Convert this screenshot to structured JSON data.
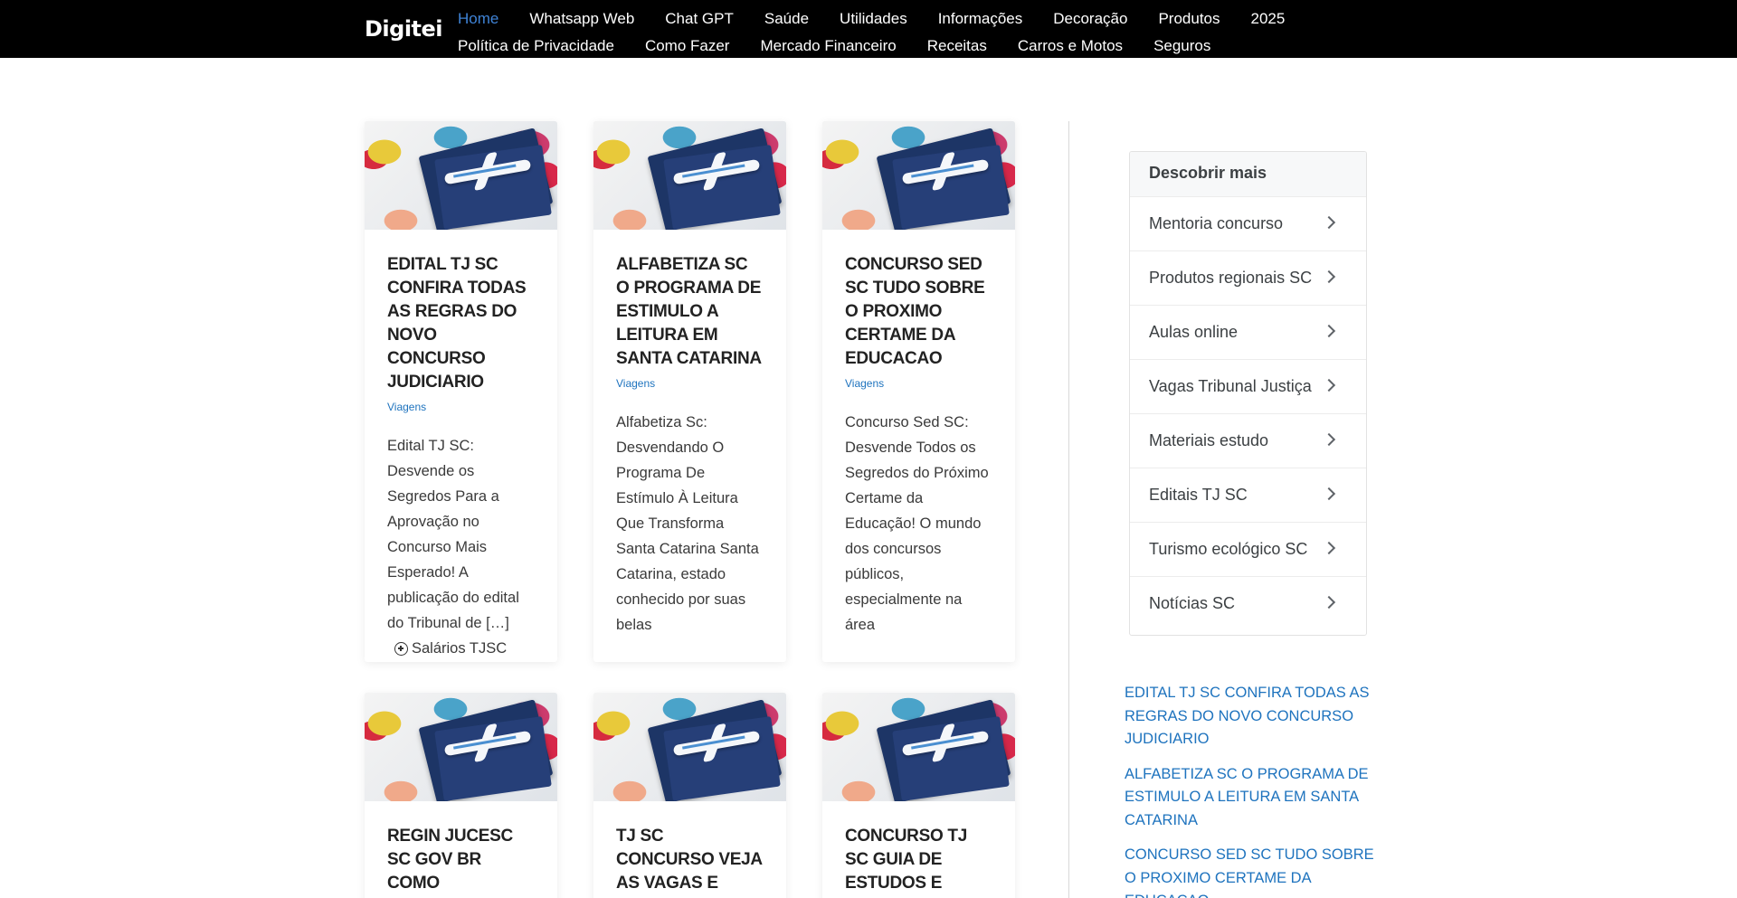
{
  "site": {
    "logo": "Digitei"
  },
  "nav": {
    "row1": [
      "Home",
      "Whatsapp Web",
      "Chat GPT",
      "Saúde",
      "Utilidades",
      "Informações",
      "Decoração",
      "Produtos",
      "2025"
    ],
    "row2": [
      "Política de Privacidade",
      "Como Fazer",
      "Mercado Financeiro",
      "Receitas",
      "Carros e Motos",
      "Seguros"
    ],
    "active": "Home"
  },
  "posts": [
    {
      "title": "EDITAL TJ SC CONFIRA TODAS AS REGRAS DO NOVO CONCURSO JUDICIARIO",
      "category": "Viagens",
      "excerpt": "Edital TJ SC: Desvende os Segredos Para a Aprovação no Concurso Mais Esperado! A publicação do edital do Tribunal de […]",
      "extra": "Salários TJSC"
    },
    {
      "title": "ALFABETIZA SC O PROGRAMA DE ESTIMULO A LEITURA EM SANTA CATARINA",
      "category": "Viagens",
      "excerpt": "Alfabetiza Sc: Desvendando O Programa De Estímulo À Leitura Que Transforma Santa Catarina Santa Catarina, estado conhecido por suas belas"
    },
    {
      "title": "CONCURSO SED SC TUDO SOBRE O PROXIMO CERTAME DA EDUCACAO",
      "category": "Viagens",
      "excerpt": "Concurso Sed SC: Desvende Todos os Segredos do Próximo Certame da Educação! O mundo dos concursos públicos, especialmente na área"
    },
    {
      "title": "REGIN JUCESC SC GOV BR COMO REGISTRAR SUA"
    },
    {
      "title": "TJ SC CONCURSO VEJA AS VAGAS E SALARIOS PARA O"
    },
    {
      "title": "CONCURSO TJ SC GUIA DE ESTUDOS E INFORMACOES"
    }
  ],
  "sidebar": {
    "widget_title": "Descobrir mais",
    "items": [
      "Mentoria concurso",
      "Produtos regionais SC",
      "Aulas online",
      "Vagas Tribunal Justiça",
      "Materiais estudo",
      "Editais TJ SC",
      "Turismo ecológico SC",
      "Notícias SC"
    ],
    "recent": [
      "EDITAL TJ SC CONFIRA TODAS AS REGRAS DO NOVO CONCURSO JUDICIARIO",
      "ALFABETIZA SC O PROGRAMA DE ESTIMULO A LEITURA EM SANTA CATARINA",
      "CONCURSO SED SC TUDO SOBRE O PROXIMO CERTAME DA EDUCACAO"
    ]
  },
  "colors": {
    "header_bg": "#000000",
    "nav_active": "#3f83d6",
    "link": "#1e73be"
  }
}
